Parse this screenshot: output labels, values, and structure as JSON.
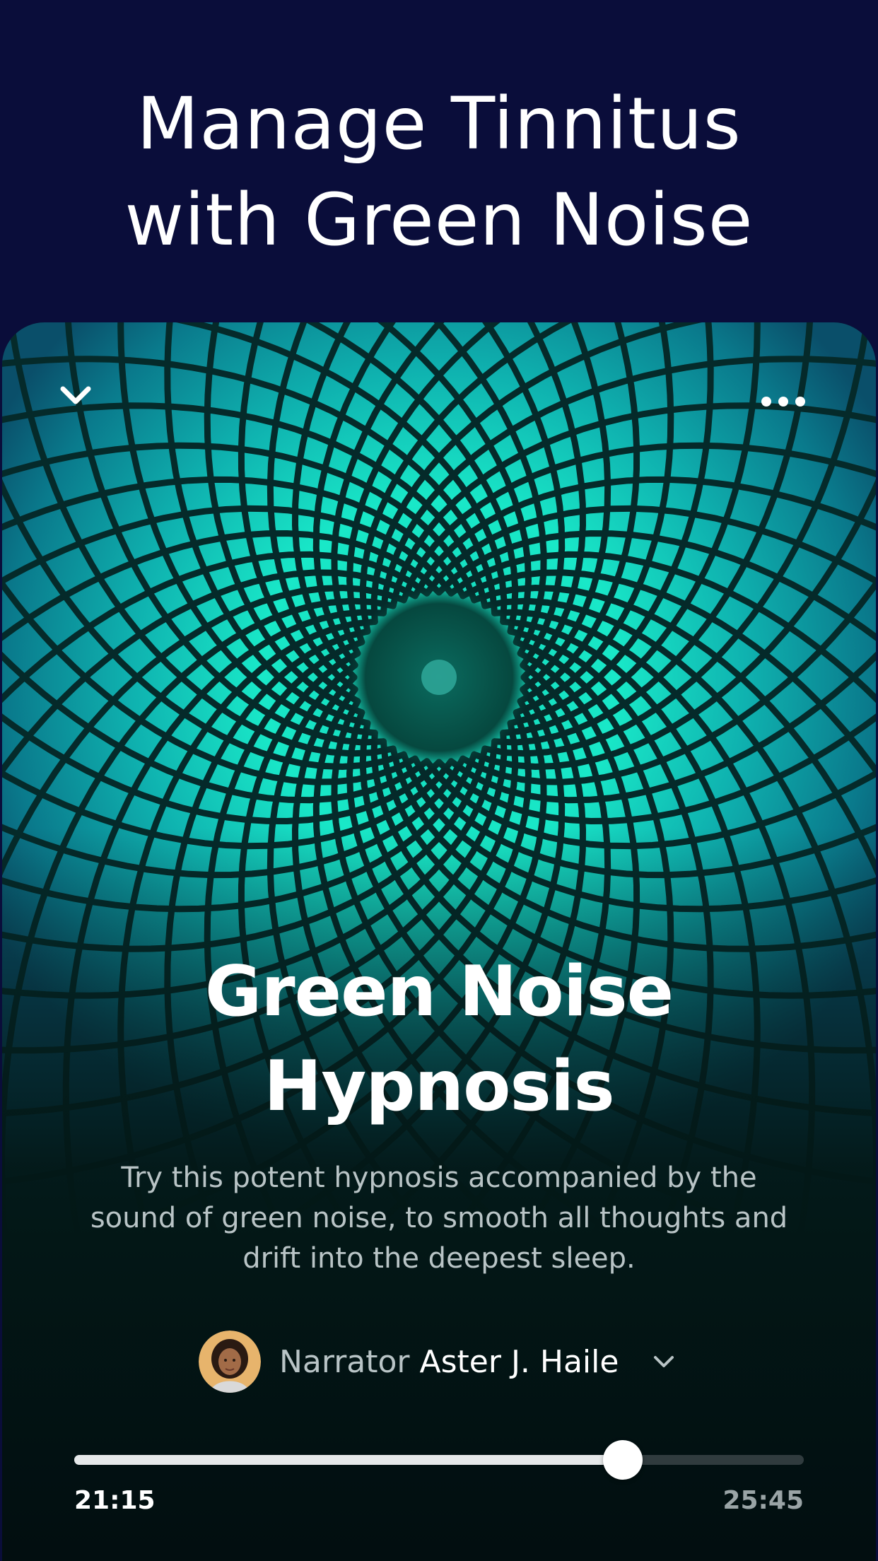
{
  "promo": {
    "title": "Manage Tinnitus\nwith Green Noise"
  },
  "player": {
    "collapse_icon": "chevron-down-icon",
    "more_icon": "more-horizontal-icon",
    "title": "Green Noise\nHypnosis",
    "description": "Try this potent hypnosis accompanied by the sound of green noise, to smooth all thoughts and drift into the deepest sleep.",
    "narrator": {
      "label": "Narrator",
      "name": "Aster J. Haile",
      "avatar_icon": "narrator-avatar",
      "chevron_icon": "chevron-down-icon"
    },
    "progress": {
      "elapsed": "21:15",
      "total": "25:45",
      "fraction": 0.752
    }
  },
  "colors": {
    "header_bg": "#0a0d3a",
    "art_teal": "#19e0c4",
    "card_bg": "#031716"
  }
}
